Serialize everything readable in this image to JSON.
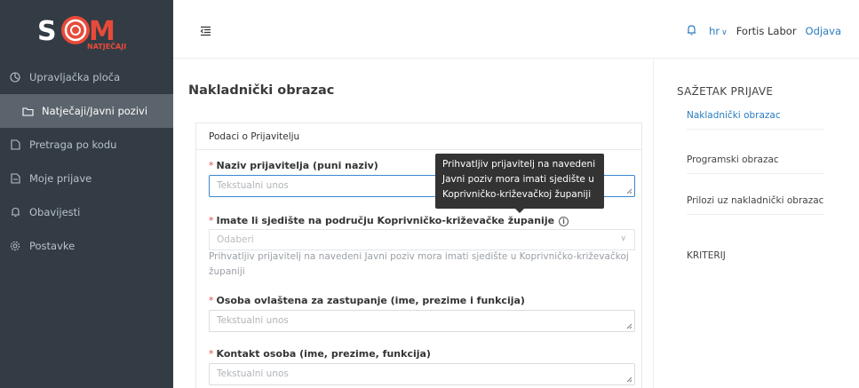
{
  "brand": {
    "logo_text": "SOM",
    "logo_sub": "NATJEČAJI",
    "colors": {
      "accent": "#e84a3a",
      "sidebar": "#333c44",
      "link": "#2a7bc0"
    }
  },
  "sidebar": {
    "items": [
      {
        "label": "Upravljačka ploča",
        "icon": "dashboard-icon"
      },
      {
        "label": "Natječaji/Javni pozivi",
        "icon": "folder-icon",
        "active": true
      },
      {
        "label": "Pretraga po kodu",
        "icon": "document-icon"
      },
      {
        "label": "Moje prijave",
        "icon": "document-icon"
      },
      {
        "label": "Obavijesti",
        "icon": "bell-icon"
      },
      {
        "label": "Postavke",
        "icon": "gear-icon"
      }
    ]
  },
  "header": {
    "language": "hr",
    "organization": "Fortis Labor",
    "logout": "Odjava"
  },
  "main": {
    "title": "Nakladnički obrazac",
    "section_title": "Podaci o Prijavitelju",
    "fields": [
      {
        "label": "Naziv prijavitelja (puni naziv)",
        "placeholder": "Tekstualni unos"
      },
      {
        "label": "Imate li sjedište na području Koprivničko-križevačke županije",
        "placeholder": "Odaberi",
        "help": "Prihvatljiv prijavitelj na navedeni Javni poziv mora imati sjedište u Koprivničko-križevačkoj županiji"
      },
      {
        "label": "Osoba ovlaštena za zastupanje (ime, prezime i funkcija)",
        "placeholder": "Tekstualni unos"
      },
      {
        "label": "Kontakt osoba (ime, prezime, funkcija)",
        "placeholder": "Tekstualni unos"
      }
    ],
    "tooltip": "Prihvatljiv prijavitelj na navedeni Javni poziv mora imati sjedište u Koprivničko-križevačkoj županiji"
  },
  "summary": {
    "title": "SAŽETAK PRIJAVE",
    "items": [
      {
        "label": "Nakladnički obrazac",
        "active": true
      },
      {
        "label": "Programski obrazac"
      },
      {
        "label": "Prilozi uz nakladnički obrazac"
      },
      {
        "label": "KRITERIJ"
      }
    ]
  }
}
